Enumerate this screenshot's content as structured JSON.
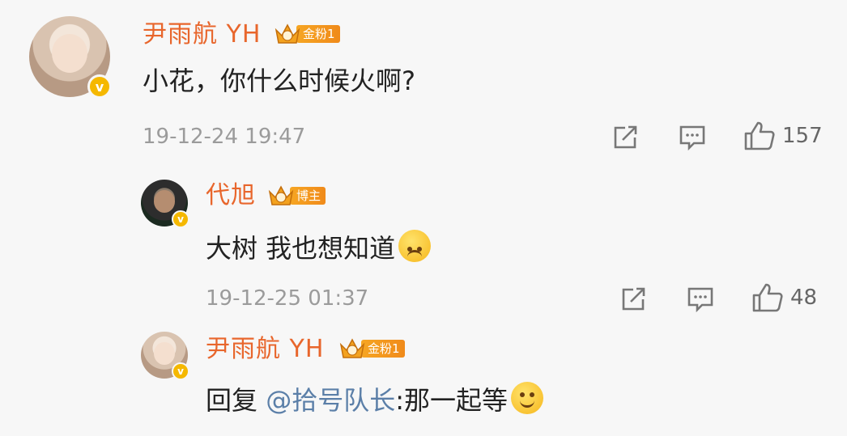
{
  "comments": [
    {
      "user": "尹雨航 YH",
      "badge": "金粉1",
      "text": "小花，你什么时候火啊?",
      "time": "19-12-24 19:47",
      "likes": "157"
    },
    {
      "user": "代旭",
      "badge": "博主",
      "text": "大树 我也想知道",
      "time": "19-12-25 01:37",
      "likes": "48"
    },
    {
      "user": "尹雨航 YH",
      "badge": "金粉1",
      "text_prefix": "回复 ",
      "mention": "@拾号队长",
      "text_suffix": ":那一起等"
    }
  ],
  "icons": {
    "verified": "v",
    "share": "share-icon",
    "reply": "comment-icon",
    "like": "thumbs-up-icon"
  },
  "colors": {
    "username": "#e8662c",
    "badge": "#f39a1f",
    "mention": "#5b7fa8",
    "timestamp": "#9b9b9b",
    "verified": "#f5b800"
  }
}
